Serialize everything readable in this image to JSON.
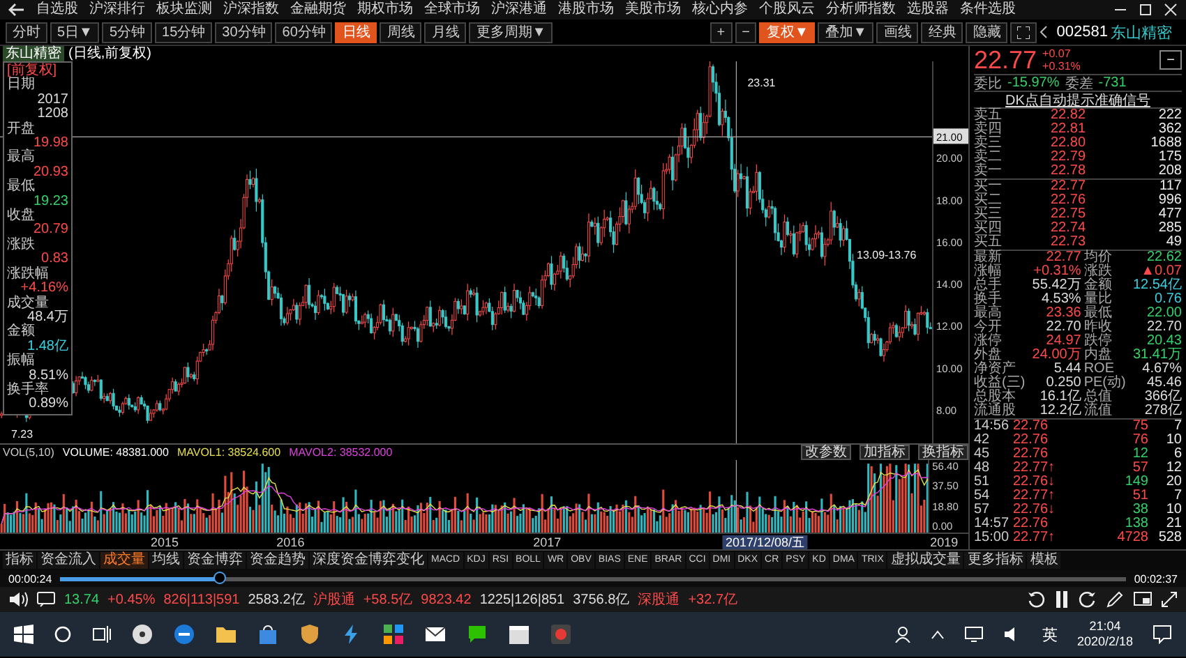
{
  "menu": [
    "自选股",
    "沪深排行",
    "板块监测",
    "沪深指数",
    "金融期货",
    "期权市场",
    "全球市场",
    "沪深港通",
    "港股市场",
    "美股市场",
    "核心内参",
    "个股风云",
    "分析师指数",
    "选股器",
    "条件选股"
  ],
  "periods": [
    {
      "label": "分时",
      "selected": false
    },
    {
      "label": "5日▼",
      "selected": false
    },
    {
      "label": "5分钟",
      "selected": false
    },
    {
      "label": "15分钟",
      "selected": false
    },
    {
      "label": "30分钟",
      "selected": false
    },
    {
      "label": "60分钟",
      "selected": false
    },
    {
      "label": "日线",
      "selected": true
    },
    {
      "label": "周线",
      "selected": false
    },
    {
      "label": "月线",
      "selected": false
    },
    {
      "label": "更多周期▼",
      "selected": false
    }
  ],
  "tools": [
    {
      "label": "+",
      "selected": false
    },
    {
      "label": "−",
      "selected": false
    },
    {
      "label": "复权▼",
      "selected": true
    },
    {
      "label": "叠加▼",
      "selected": false
    },
    {
      "label": "画线",
      "selected": false
    },
    {
      "label": "经典",
      "selected": false
    },
    {
      "label": "隐藏",
      "selected": false
    }
  ],
  "stock": {
    "code": "002581",
    "name": "东山精密"
  },
  "chart": {
    "title": "东山精密",
    "subtitle": "(日线,前复权)",
    "price_ticks": [
      "20.00",
      "18.00",
      "16.00",
      "14.00",
      "12.00",
      "10.00",
      "8.00"
    ],
    "crosshair_price": "21.00",
    "high_label": "23.31",
    "low_label": "7.23",
    "range_label": "13.09-13.76"
  },
  "info_panel": {
    "header": "[前复权]",
    "rows": [
      {
        "label": "日期",
        "lines": [
          "2017",
          "1208"
        ],
        "color": "#dedede"
      },
      {
        "label": "开盘",
        "lines": [
          "19.98"
        ],
        "color": "#ff4a4a"
      },
      {
        "label": "最高",
        "lines": [
          "20.93"
        ],
        "color": "#ff4a4a"
      },
      {
        "label": "最低",
        "lines": [
          "19.23"
        ],
        "color": "#33d16b"
      },
      {
        "label": "收盘",
        "lines": [
          "20.79"
        ],
        "color": "#ff4a4a"
      },
      {
        "label": "涨跌",
        "lines": [
          "0.83"
        ],
        "color": "#ff4a4a"
      },
      {
        "label": "涨跌幅",
        "lines": [
          "+4.16%"
        ],
        "color": "#ff4a4a"
      },
      {
        "label": "成交量",
        "lines": [
          "48.4万"
        ],
        "color": "#dedede"
      },
      {
        "label": "金额",
        "lines": [
          "1.48亿"
        ],
        "color": "#3ccfe0"
      },
      {
        "label": "振幅",
        "lines": [
          "8.51%"
        ],
        "color": "#dedede"
      },
      {
        "label": "换手率",
        "lines": [
          "0.89%"
        ],
        "color": "#dedede"
      }
    ]
  },
  "volume": {
    "indicator": "VOL(5,10)",
    "readings": [
      {
        "text": "VOLUME: 48381.000",
        "color": "#ffffff"
      },
      {
        "text": "MAVOL1: 38524.600",
        "color": "#e8e04a"
      },
      {
        "text": "MAVOL2: 38532.000",
        "color": "#e040e0"
      }
    ],
    "buttons": [
      "改参数",
      "加指标",
      "换指标"
    ],
    "ticks": [
      "56.40",
      "37.50",
      "18.80",
      "0.00"
    ]
  },
  "date_axis": [
    {
      "label": "2015",
      "highlighted": false
    },
    {
      "label": "2016",
      "highlighted": false
    },
    {
      "label": "2017",
      "highlighted": false
    },
    {
      "label": "2017/12/08/五",
      "highlighted": true
    },
    {
      "label": "2019",
      "highlighted": false
    }
  ],
  "quote": {
    "price": "22.77",
    "change": "+0.07",
    "percent": "+0.31%",
    "color": "#ff4a4a",
    "toggle": "−",
    "ratio_label": "委比",
    "ratio": "-15.97%",
    "diff_label": "委差",
    "diff": "-731",
    "signal": "DK点自动提示准确信号"
  },
  "asks": [
    {
      "label": "卖五",
      "price": "22.82",
      "volume": "222"
    },
    {
      "label": "卖四",
      "price": "22.81",
      "volume": "362"
    },
    {
      "label": "卖三",
      "price": "22.80",
      "volume": "1688"
    },
    {
      "label": "卖二",
      "price": "22.79",
      "volume": "175"
    },
    {
      "label": "卖一",
      "price": "22.78",
      "volume": "208"
    }
  ],
  "bids": [
    {
      "label": "买一",
      "price": "22.77",
      "volume": "117"
    },
    {
      "label": "买二",
      "price": "22.76",
      "volume": "996"
    },
    {
      "label": "买三",
      "price": "22.75",
      "volume": "477"
    },
    {
      "label": "买四",
      "price": "22.74",
      "volume": "285"
    },
    {
      "label": "买五",
      "price": "22.73",
      "volume": "49"
    }
  ],
  "stats": [
    {
      "label": "最新",
      "value": "22.77",
      "color": "#ff4a4a"
    },
    {
      "label": "均价",
      "value": "22.62",
      "color": "#33d16b"
    },
    {
      "label": "涨幅",
      "value": "+0.31%",
      "color": "#ff4a4a"
    },
    {
      "label": "涨跌",
      "value": "▲0.07",
      "color": "#ff4a4a"
    },
    {
      "label": "总手",
      "value": "55.42万",
      "color": "#dedede"
    },
    {
      "label": "金额",
      "value": "12.54亿",
      "color": "#3ccfe0"
    },
    {
      "label": "换手",
      "value": "4.53%",
      "color": "#dedede"
    },
    {
      "label": "量比",
      "value": "0.76",
      "color": "#3ccfe0"
    },
    {
      "label": "最高",
      "value": "23.36",
      "color": "#ff4a4a"
    },
    {
      "label": "最低",
      "value": "22.00",
      "color": "#33d16b"
    },
    {
      "label": "今开",
      "value": "22.70",
      "color": "#dedede"
    },
    {
      "label": "昨收",
      "value": "22.70",
      "color": "#dedede"
    },
    {
      "label": "涨停",
      "value": "24.97",
      "color": "#ff4a4a"
    },
    {
      "label": "跌停",
      "value": "20.43",
      "color": "#33d16b"
    },
    {
      "label": "外盘",
      "value": "24.00万",
      "color": "#ff4a4a"
    },
    {
      "label": "内盘",
      "value": "31.41万",
      "color": "#33d16b"
    },
    {
      "label": "净资产",
      "value": "5.44",
      "color": "#dedede"
    },
    {
      "label": "ROE",
      "value": "4.67%",
      "color": "#dedede"
    },
    {
      "label": "收益(三)",
      "value": "0.250",
      "color": "#dedede"
    },
    {
      "label": "PE(动)",
      "value": "45.46",
      "color": "#dedede"
    },
    {
      "label": "总股本",
      "value": "16.1亿",
      "color": "#dedede"
    },
    {
      "label": "总值",
      "value": "366亿",
      "color": "#dedede"
    },
    {
      "label": "流通股",
      "value": "12.2亿",
      "color": "#dedede"
    },
    {
      "label": "流值",
      "value": "278亿",
      "color": "#dedede"
    }
  ],
  "ticks": [
    {
      "time": "14:56",
      "price": "22.76",
      "volume": "75",
      "count": "7",
      "color": "#ff4a4a"
    },
    {
      "time": "42",
      "price": "22.76",
      "volume": "76",
      "count": "10",
      "color": "#ff4a4a"
    },
    {
      "time": "45",
      "price": "22.76",
      "volume": "12",
      "count": "6",
      "color": "#33d16b"
    },
    {
      "time": "48",
      "price": "22.77↑",
      "volume": "57",
      "count": "12",
      "color": "#ff4a4a"
    },
    {
      "time": "51",
      "price": "22.76↓",
      "volume": "149",
      "count": "20",
      "color": "#33d16b"
    },
    {
      "time": "54",
      "price": "22.77↑",
      "volume": "51",
      "count": "7",
      "color": "#ff4a4a"
    },
    {
      "time": "57",
      "price": "22.76↓",
      "volume": "38",
      "count": "10",
      "color": "#33d16b"
    },
    {
      "time": "14:57",
      "price": "22.76",
      "volume": "138",
      "count": "21",
      "color": "#33d16b"
    },
    {
      "time": "15:00",
      "price": "22.77↑",
      "volume": "4728",
      "count": "528",
      "color": "#ff4a4a"
    }
  ],
  "indicator_tabs": [
    {
      "label": "指标",
      "kind": "name",
      "selected": false
    },
    {
      "label": "资金流入",
      "kind": "name",
      "selected": false
    },
    {
      "label": "成交量",
      "kind": "name",
      "selected": true
    },
    {
      "label": "均线",
      "kind": "name",
      "selected": false
    },
    {
      "label": "资金博弈",
      "kind": "name",
      "selected": false
    },
    {
      "label": "资金趋势",
      "kind": "name",
      "selected": false
    },
    {
      "label": "深度资金博弈变化",
      "kind": "name",
      "selected": false
    },
    {
      "label": "MACD",
      "kind": "code",
      "selected": false
    },
    {
      "label": "KDJ",
      "kind": "code",
      "selected": false
    },
    {
      "label": "RSI",
      "kind": "code",
      "selected": false
    },
    {
      "label": "BOLL",
      "kind": "code",
      "selected": false
    },
    {
      "label": "WR",
      "kind": "code",
      "selected": false
    },
    {
      "label": "OBV",
      "kind": "code",
      "selected": false
    },
    {
      "label": "BIAS",
      "kind": "code",
      "selected": false
    },
    {
      "label": "ENE",
      "kind": "code",
      "selected": false
    },
    {
      "label": "BRAR",
      "kind": "code",
      "selected": false
    },
    {
      "label": "CCI",
      "kind": "code",
      "selected": false
    },
    {
      "label": "DMI",
      "kind": "code",
      "selected": false
    },
    {
      "label": "DKX",
      "kind": "code",
      "selected": false
    },
    {
      "label": "CR",
      "kind": "code",
      "selected": false
    },
    {
      "label": "PSY",
      "kind": "code",
      "selected": false
    },
    {
      "label": "KD",
      "kind": "code",
      "selected": false
    },
    {
      "label": "DMA",
      "kind": "code",
      "selected": false
    },
    {
      "label": "TRIX",
      "kind": "code",
      "selected": false
    },
    {
      "label": "虚拟成交量",
      "kind": "name",
      "selected": false
    },
    {
      "label": "更多指标",
      "kind": "name",
      "selected": false
    },
    {
      "label": "模板",
      "kind": "name",
      "selected": false
    }
  ],
  "player": {
    "elapsed": "00:00:24",
    "duration": "00:02:37",
    "level": 0.15
  },
  "status_bar": [
    {
      "text": "13.74",
      "color": "#33d16b"
    },
    {
      "text": "+0.45%",
      "color": "#ff4a4a"
    },
    {
      "text": "826|113|591",
      "color": "#ff4a4a"
    },
    {
      "text": "2583.2亿",
      "color": "#dedede"
    },
    {
      "text": "沪股通",
      "color": "#ff4a4a"
    },
    {
      "text": "+58.5亿",
      "color": "#ff4a4a"
    },
    {
      "text": "9823.42",
      "color": "#ff4a4a"
    },
    {
      "text": "1225|126|851",
      "color": "#dedede"
    },
    {
      "text": "3756.8亿",
      "color": "#dedede"
    },
    {
      "text": "深股通",
      "color": "#ff4a4a"
    },
    {
      "text": "+32.7亿",
      "color": "#ff4a4a"
    }
  ],
  "taskbar": {
    "ime": "英",
    "time": "21:04",
    "date": "2020/2/18"
  }
}
